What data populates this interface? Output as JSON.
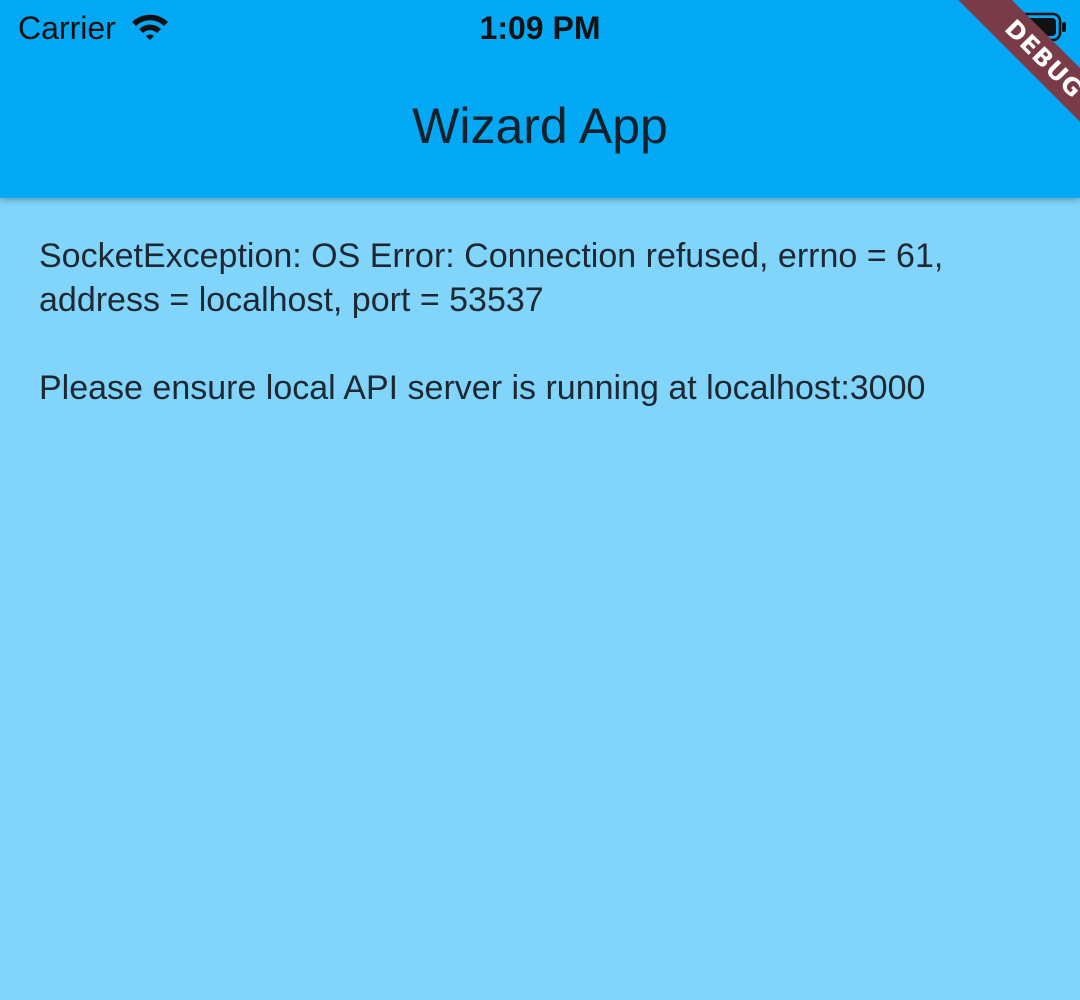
{
  "status_bar": {
    "carrier": "Carrier",
    "time": "1:09 PM",
    "wifi_icon": "wifi-icon",
    "battery_icon": "battery-icon"
  },
  "app_bar": {
    "title": "Wizard App",
    "color": "#03a9f4"
  },
  "debug_banner": {
    "label": "DEBUG",
    "color": "#7a3b49"
  },
  "content": {
    "background_color": "#81d4fa",
    "error_message": "SocketException: OS Error: Connection refused, errno = 61, address = localhost, port = 53537",
    "hint_message": "Please ensure local API server is running at localhost:3000"
  }
}
